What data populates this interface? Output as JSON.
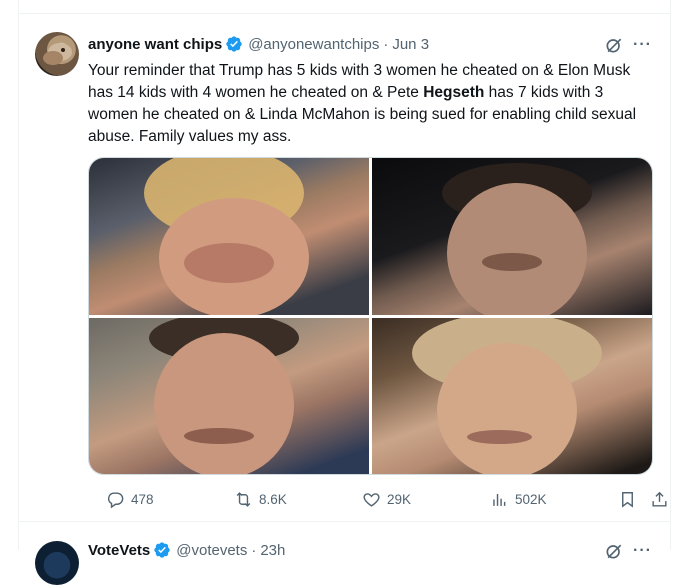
{
  "tweet": {
    "display_name": "anyone want chips",
    "handle": "@anyonewantchips",
    "separator": "·",
    "date": "Jun 3",
    "text_before": "Your reminder that Trump has 5 kids with 3 women he cheated on & Elon Musk has 14 kids with 4 women he cheated on & Pete ",
    "text_bold": "Hegseth",
    "text_after": " has 7 kids with 3 women he cheated on & Linda McMahon is being sued for enabling child sexual abuse. Family values my ass.",
    "more_label": "···",
    "stats": {
      "replies": "478",
      "retweets": "8.6K",
      "likes": "29K",
      "views": "502K"
    }
  },
  "next_tweet": {
    "display_name": "VoteVets",
    "handle": "@votevets",
    "separator": "·",
    "date": "23h"
  },
  "colors": {
    "verified": "#1d9bf0",
    "secondary_text": "#536471",
    "border": "#eff3f4"
  },
  "icons": [
    "verified-badge-icon",
    "grok-icon",
    "more-icon",
    "reply-icon",
    "retweet-icon",
    "like-icon",
    "views-icon",
    "bookmark-icon",
    "share-icon"
  ]
}
